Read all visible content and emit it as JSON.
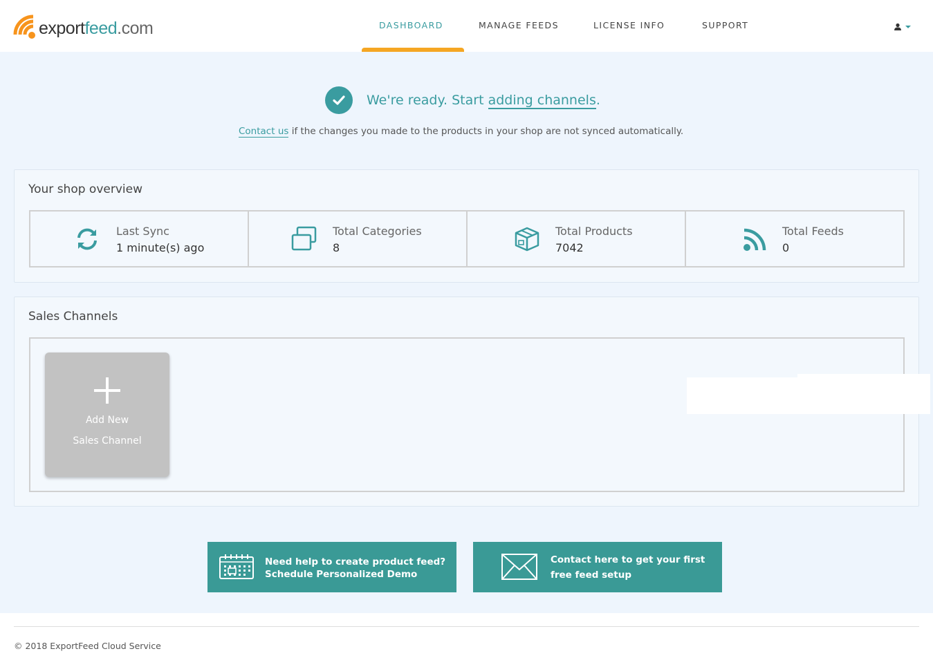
{
  "header": {
    "logo": {
      "part1": "export",
      "part2": "feed",
      "part3": ".com"
    },
    "nav": [
      {
        "label": "DASHBOARD",
        "active": true
      },
      {
        "label": "MANAGE FEEDS",
        "active": false
      },
      {
        "label": "LICENSE INFO",
        "active": false
      },
      {
        "label": "SUPPORT",
        "active": false
      }
    ],
    "user_icon": "user-icon"
  },
  "status": {
    "ready_prefix": "We're ready. Start ",
    "ready_link": "adding channels",
    "ready_suffix": ".",
    "note_link": "Contact us",
    "note_text": " if the changes you made to the products in your shop are not synced automatically."
  },
  "overview": {
    "title": "Your shop overview",
    "stats": [
      {
        "label": "Last Sync",
        "value": "1 minute(s) ago",
        "icon": "sync-icon"
      },
      {
        "label": "Total Categories",
        "value": "8",
        "icon": "categories-icon"
      },
      {
        "label": "Total Products",
        "value": "7042",
        "icon": "box-icon"
      },
      {
        "label": "Total Feeds",
        "value": "0",
        "icon": "rss-icon"
      }
    ]
  },
  "channels": {
    "title": "Sales Channels",
    "add_line1": "Add New",
    "add_line2": "Sales Channel"
  },
  "cta": {
    "demo_line1": "Need help to create product feed?",
    "demo_line2": "Schedule Personalized Demo",
    "contact_line1": "Contact here to get your first",
    "contact_line2": "free feed setup"
  },
  "footer": {
    "text": "© 2018 ExportFeed Cloud Service"
  },
  "colors": {
    "accent": "#3a9ca0",
    "nav_underline": "#f5a623",
    "logo_orange": "#f7941d",
    "page_bg": "#eef5fd"
  }
}
